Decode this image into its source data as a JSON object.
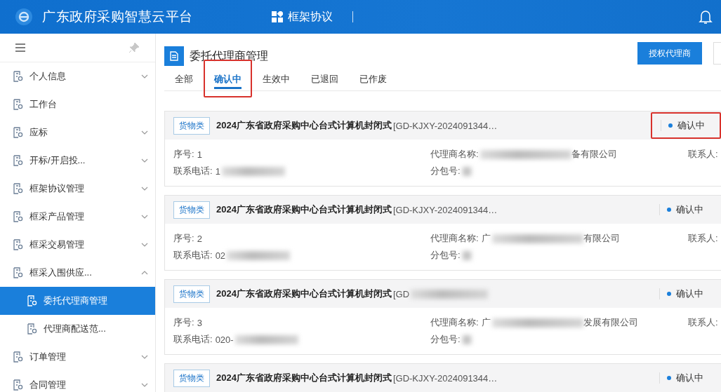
{
  "header": {
    "title": "广东政府采购智慧云平台",
    "module": "框架协议"
  },
  "sidebar": {
    "items": [
      {
        "label": "个人信息",
        "kind": "group",
        "expanded": false,
        "selected": false
      },
      {
        "label": "工作台",
        "kind": "link",
        "selected": false
      },
      {
        "label": "应标",
        "kind": "group",
        "expanded": false,
        "selected": false
      },
      {
        "label": "开标/开启投...",
        "kind": "group",
        "expanded": false,
        "selected": false
      },
      {
        "label": "框架协议管理",
        "kind": "group",
        "expanded": false,
        "selected": false
      },
      {
        "label": "框采产品管理",
        "kind": "group",
        "expanded": false,
        "selected": false
      },
      {
        "label": "框采交易管理",
        "kind": "group",
        "expanded": false,
        "selected": false
      },
      {
        "label": "框采入围供应...",
        "kind": "group",
        "expanded": true,
        "selected": false,
        "children": [
          {
            "label": "委托代理商管理",
            "selected": true
          },
          {
            "label": "代理商配送范...",
            "selected": false
          }
        ]
      },
      {
        "label": "订单管理",
        "kind": "group",
        "expanded": false,
        "selected": false
      },
      {
        "label": "合同管理",
        "kind": "group",
        "expanded": false,
        "selected": false
      }
    ]
  },
  "page": {
    "title": "委托代理商管理",
    "button": "授权代理商"
  },
  "tabs": [
    {
      "label": "全部",
      "selected": false,
      "highlighted": false
    },
    {
      "label": "确认中",
      "selected": true,
      "highlighted": true
    },
    {
      "label": "生效中",
      "selected": false,
      "highlighted": false
    },
    {
      "label": "已退回",
      "selected": false,
      "highlighted": false
    },
    {
      "label": "已作废",
      "selected": false,
      "highlighted": false
    }
  ],
  "cards": [
    {
      "category": "货物类",
      "title": "2024广东省政府采购中心台式计算机封闭式",
      "code": "[GD-KJXY-2024091344…",
      "code_redacted": false,
      "status": "确认中",
      "status_highlighted": true,
      "fields": [
        {
          "label": "序号:",
          "value": "1",
          "redacted": false
        },
        {
          "label": "代理商名称:",
          "redacted": true,
          "value_end": "备有限公司"
        },
        {
          "label": "联系人:",
          "redacted": false
        },
        {
          "label": "联系电话:",
          "value": "1",
          "redacted": true
        },
        {
          "label": "分包号:",
          "redacted": true
        }
      ]
    },
    {
      "category": "货物类",
      "title": "2024广东省政府采购中心台式计算机封闭式",
      "code": "[GD-KJXY-2024091344…",
      "code_redacted": false,
      "status": "确认中",
      "status_highlighted": false,
      "fields": [
        {
          "label": "序号:",
          "value": "2",
          "redacted": false
        },
        {
          "label": "代理商名称:",
          "value": "广",
          "redacted": true,
          "value_end": "有限公司"
        },
        {
          "label": "联系人:",
          "redacted": false
        },
        {
          "label": "联系电话:",
          "value": "02",
          "redacted": true
        },
        {
          "label": "分包号:",
          "redacted": true
        }
      ]
    },
    {
      "category": "货物类",
      "title": "2024广东省政府采购中心台式计算机封闭式",
      "code": "[GD",
      "code_redacted": true,
      "status": "确认中",
      "status_highlighted": false,
      "fields": [
        {
          "label": "序号:",
          "value": "3",
          "redacted": false
        },
        {
          "label": "代理商名称:",
          "value": "广",
          "redacted": true,
          "value_end": "发展有限公司"
        },
        {
          "label": "联系人:",
          "redacted": false
        },
        {
          "label": "联系电话:",
          "value": "020-",
          "redacted": true
        },
        {
          "label": "分包号:",
          "redacted": true
        }
      ]
    },
    {
      "category": "货物类",
      "title": "2024广东省政府采购中心台式计算机封闭式",
      "code": "[GD-KJXY-2024091344…",
      "code_redacted": false,
      "status": "确认中",
      "status_highlighted": false
    }
  ]
}
